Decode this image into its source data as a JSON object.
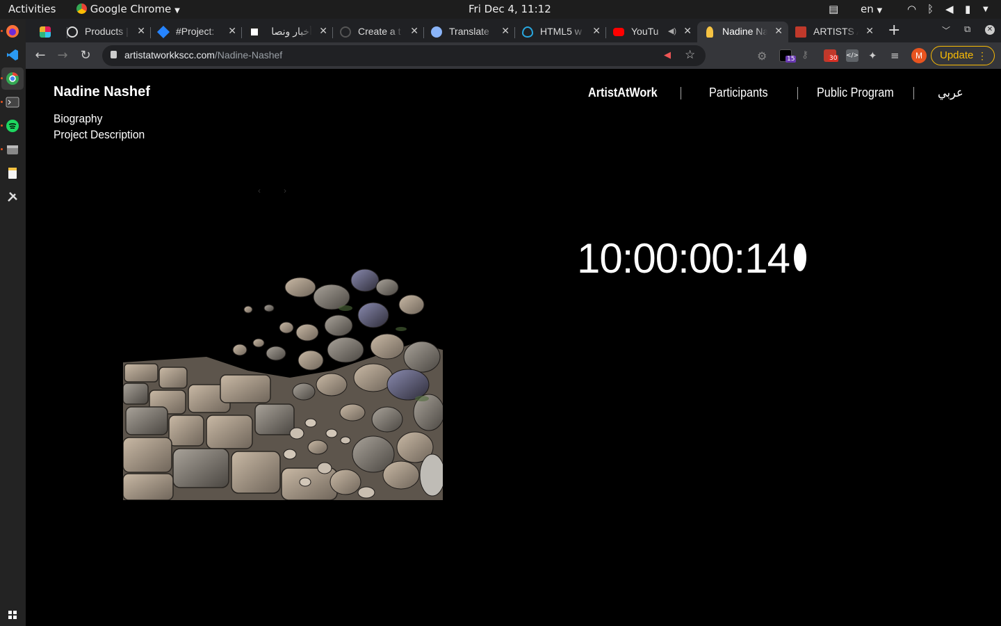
{
  "system_bar": {
    "activities": "Activities",
    "app_name": "Google Chrome",
    "datetime": "Fri Dec  4, 11:12",
    "lang": "en"
  },
  "browser": {
    "tabs": [
      {
        "label": "",
        "icon": "slack-icon"
      },
      {
        "label": "Products |",
        "icon": "globe-icon"
      },
      {
        "label": "#Project:",
        "icon": "jira-icon"
      },
      {
        "label": "أخبار ونصا",
        "icon": "news-icon"
      },
      {
        "label": "Create a t",
        "icon": "github-icon"
      },
      {
        "label": "Translate",
        "icon": "translate-icon"
      },
      {
        "label": "HTML5 w",
        "icon": "drupal-icon"
      },
      {
        "label": "YouTu",
        "icon": "youtube-icon"
      },
      {
        "label": "Nadine Na",
        "icon": "bell-icon",
        "active": true
      },
      {
        "label": "ARTISTS A",
        "icon": "artists-icon"
      }
    ],
    "url_host": "artistatworkkscc.com",
    "url_path": "/Nadine-Nashef",
    "badge_gmail": "30",
    "badge_ext": "15",
    "avatar_letter": "M",
    "update_label": "Update"
  },
  "page": {
    "artist_name": "Nadine Nashef",
    "links": [
      "Biography",
      "Project Description"
    ],
    "nav": [
      "ArtistAtWork",
      "Participants",
      "Public Program",
      "عربي"
    ],
    "slider_prev": "‹",
    "slider_next": "›",
    "timecode": "10:00:00:14"
  }
}
